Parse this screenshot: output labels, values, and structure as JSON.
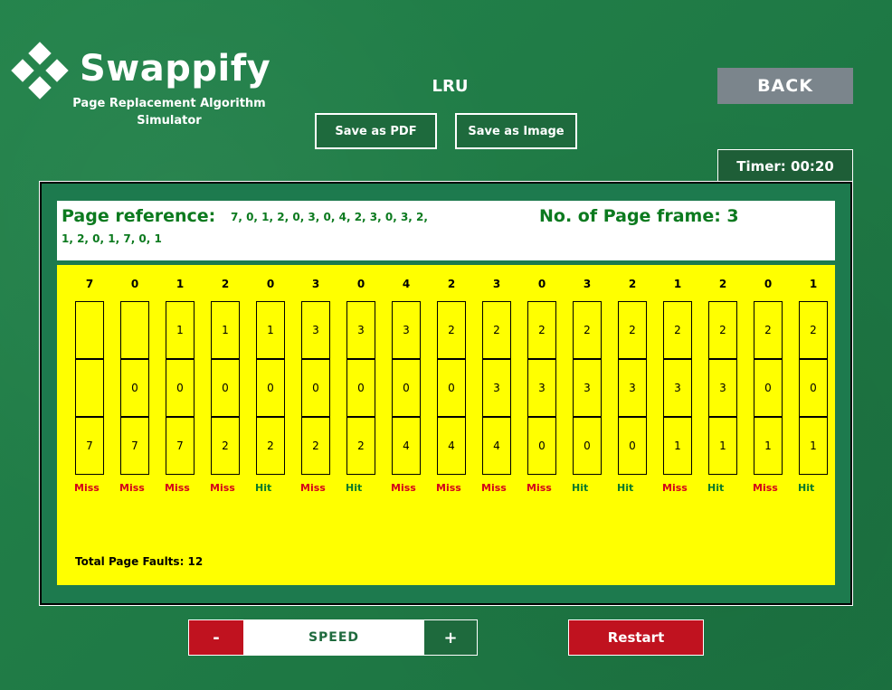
{
  "app": {
    "brand": "Swappify",
    "tagline": "Page Replacement Algorithm Simulator",
    "algorithm": "LRU"
  },
  "toolbar": {
    "save_pdf": "Save as PDF",
    "save_image": "Save as Image",
    "back": "BACK",
    "timer": "Timer: 00:20"
  },
  "info": {
    "ref_label": "Page reference:",
    "ref_line1": "7, 0, 1, 2, 0, 3, 0, 4, 2, 3, 0, 3, 2,",
    "ref_line2": "1, 2, 0, 1, 7, 0, 1",
    "frame_label": "No. of Page frame: 3"
  },
  "simulation": {
    "steps": [
      {
        "ref": "7",
        "frames": [
          "",
          "",
          "7"
        ],
        "status": "Miss"
      },
      {
        "ref": "0",
        "frames": [
          "",
          "0",
          "7"
        ],
        "status": "Miss"
      },
      {
        "ref": "1",
        "frames": [
          "1",
          "0",
          "7"
        ],
        "status": "Miss"
      },
      {
        "ref": "2",
        "frames": [
          "1",
          "0",
          "2"
        ],
        "status": "Miss"
      },
      {
        "ref": "0",
        "frames": [
          "1",
          "0",
          "2"
        ],
        "status": "Hit"
      },
      {
        "ref": "3",
        "frames": [
          "3",
          "0",
          "2"
        ],
        "status": "Miss"
      },
      {
        "ref": "0",
        "frames": [
          "3",
          "0",
          "2"
        ],
        "status": "Hit"
      },
      {
        "ref": "4",
        "frames": [
          "3",
          "0",
          "4"
        ],
        "status": "Miss"
      },
      {
        "ref": "2",
        "frames": [
          "2",
          "0",
          "4"
        ],
        "status": "Miss"
      },
      {
        "ref": "3",
        "frames": [
          "2",
          "3",
          "4"
        ],
        "status": "Miss"
      },
      {
        "ref": "0",
        "frames": [
          "2",
          "3",
          "0"
        ],
        "status": "Miss"
      },
      {
        "ref": "3",
        "frames": [
          "2",
          "3",
          "0"
        ],
        "status": "Hit"
      },
      {
        "ref": "2",
        "frames": [
          "2",
          "3",
          "0"
        ],
        "status": "Hit"
      },
      {
        "ref": "1",
        "frames": [
          "2",
          "3",
          "1"
        ],
        "status": "Miss"
      },
      {
        "ref": "2",
        "frames": [
          "2",
          "3",
          "1"
        ],
        "status": "Hit"
      },
      {
        "ref": "0",
        "frames": [
          "2",
          "0",
          "1"
        ],
        "status": "Miss"
      },
      {
        "ref": "1",
        "frames": [
          "2",
          "0",
          "1"
        ],
        "status": "Hit"
      }
    ],
    "total_faults": "Total Page Faults: 12"
  },
  "controls": {
    "minus": "-",
    "speed": "SPEED",
    "plus": "+",
    "restart": "Restart"
  }
}
